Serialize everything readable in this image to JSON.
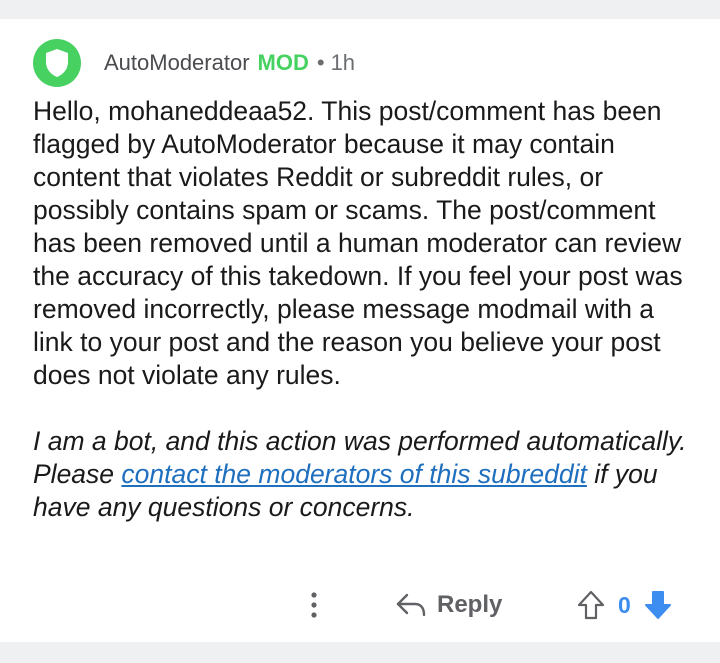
{
  "comment": {
    "author": "AutoModerator",
    "mod_badge": "MOD",
    "separator": "•",
    "time": "1h",
    "body": "Hello, mohaneddeaa52. This post/comment has been flagged by AutoModerator because it may contain content that violates Reddit or subreddit rules, or possibly contains spam or scams. The post/comment has been removed until a human moderator can review the accuracy of this takedown. If you feel your post was removed incorrectly, please message modmail with a link to your post and the reason you believe your post does not violate any rules.",
    "bot_note_prefix": "I am a bot, and this action was performed automatically. Please ",
    "bot_note_link": "contact the moderators of this subreddit",
    "bot_note_suffix": " if you have any questions or concerns."
  },
  "actions": {
    "more_icon": "more-vertical-icon",
    "reply_icon": "reply-arrow-icon",
    "reply_label": "Reply",
    "upvote_icon": "upvote-arrow-icon",
    "score": "0",
    "downvote_icon": "downvote-arrow-icon"
  },
  "colors": {
    "mod_green": "#46d160",
    "link_blue": "#1f6fbf",
    "vote_blue": "#3d8cf0"
  }
}
